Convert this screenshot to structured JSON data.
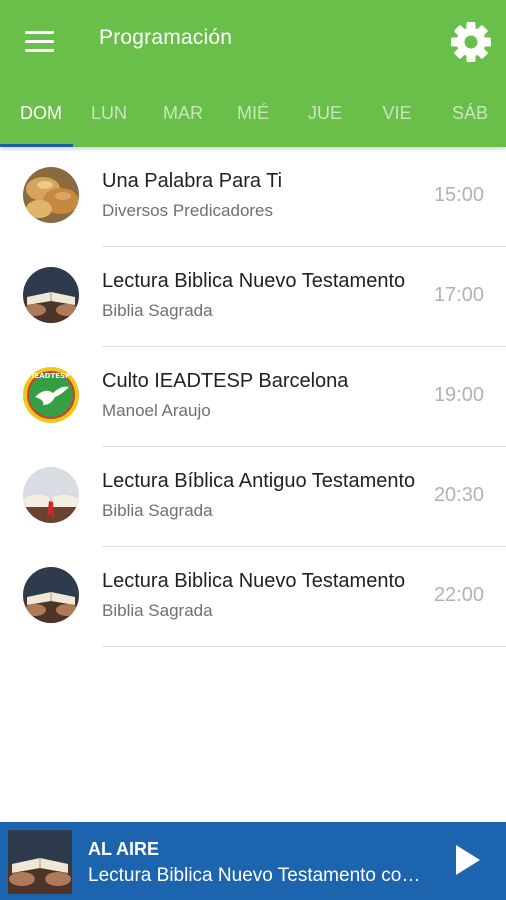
{
  "header": {
    "title": "Programación",
    "menu_icon": "hamburger-menu-icon",
    "settings_icon": "gear-icon"
  },
  "days": [
    {
      "label": "DOM",
      "active": true
    },
    {
      "label": "LUN",
      "active": false
    },
    {
      "label": "MAR",
      "active": false
    },
    {
      "label": "MIÉ",
      "active": false
    },
    {
      "label": "JUE",
      "active": false
    },
    {
      "label": "VIE",
      "active": false
    },
    {
      "label": "SÁB",
      "active": false
    }
  ],
  "schedule": [
    {
      "title": "Una Palabra Para Ti",
      "subtitle": "Diversos Predicadores",
      "time": "15:00",
      "image": "bread-loaves-image"
    },
    {
      "title": "Lectura Biblica Nuevo Testamento",
      "subtitle": "Biblia Sagrada",
      "time": "17:00",
      "image": "hands-holding-bible-image"
    },
    {
      "title": "Culto IEADTESP Barcelona",
      "subtitle": "Manoel Araujo",
      "time": "19:00",
      "image": "ieadtesp-dove-logo"
    },
    {
      "title": "Lectura Bíblica Antiguo Testamento",
      "subtitle": "Biblia Sagrada",
      "time": "20:30",
      "image": "open-bible-ribbon-image"
    },
    {
      "title": "Lectura Biblica Nuevo Testamento",
      "subtitle": "Biblia Sagrada",
      "time": "22:00",
      "image": "hands-holding-bible-image"
    }
  ],
  "player": {
    "label": "AL AIRE",
    "title": "Lectura Biblica Nuevo Testamento con la Biblia Sagrada",
    "play_icon": "play-icon",
    "image": "hands-holding-bible-image"
  },
  "logo_text": "IEADTESP",
  "colors": {
    "appbar": "#6abf4b",
    "tab_indicator": "#1f5fa6",
    "player_bar": "#1c64ad"
  }
}
